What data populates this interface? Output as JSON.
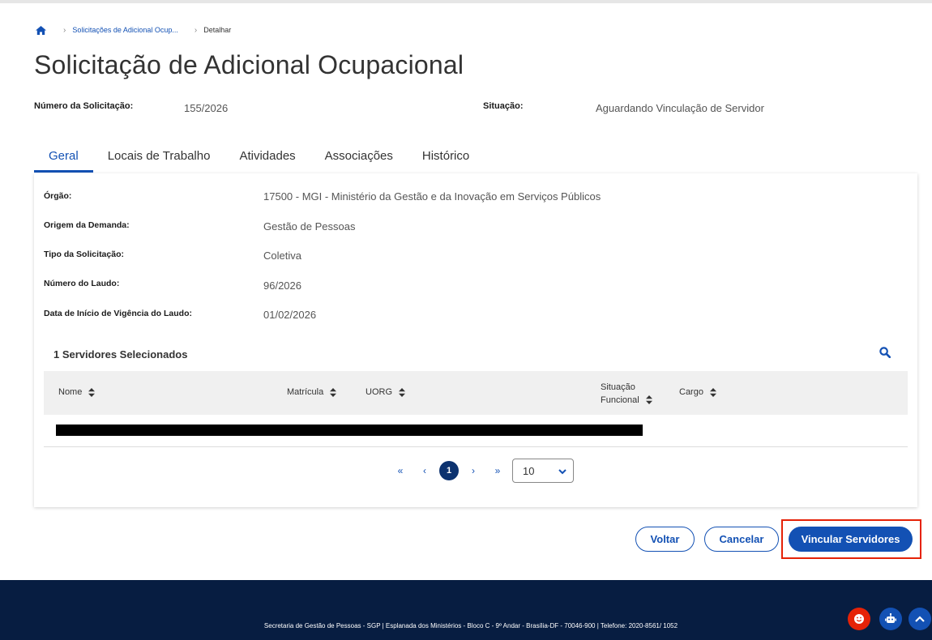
{
  "breadcrumb": {
    "items": [
      "Solicitações de Adicional Ocup...",
      "Detalhar"
    ]
  },
  "page": {
    "title": "Solicitação de Adicional Ocupacional"
  },
  "meta": {
    "numero_label": "Número da Solicitação:",
    "numero_value": "155/2026",
    "situacao_label": "Situação:",
    "situacao_value": "Aguardando Vinculação de Servidor"
  },
  "tabs": [
    {
      "label": "Geral",
      "active": true
    },
    {
      "label": "Locais de Trabalho",
      "active": false
    },
    {
      "label": "Atividades",
      "active": false
    },
    {
      "label": "Associações",
      "active": false
    },
    {
      "label": "Histórico",
      "active": false
    }
  ],
  "details": [
    {
      "label": "Órgão:",
      "value": "17500 - MGI - Ministério da Gestão e da Inovação em Serviços Públicos"
    },
    {
      "label": "Origem da Demanda:",
      "value": "Gestão de Pessoas"
    },
    {
      "label": "Tipo da Solicitação:",
      "value": "Coletiva"
    },
    {
      "label": "Número do Laudo:",
      "value": "96/2026"
    },
    {
      "label": "Data de Início de Vigência do Laudo:",
      "value": "01/02/2026"
    }
  ],
  "servidores": {
    "title": "1 Servidores Selecionados",
    "columns": {
      "nome": "Nome",
      "matricula": "Matrícula",
      "uorg": "UORG",
      "situacao_l1": "Situação",
      "situacao_l2": "Funcional",
      "cargo": "Cargo"
    }
  },
  "pagination": {
    "current_page": "1",
    "page_size": "10",
    "first": "«",
    "prev": "‹",
    "next": "›",
    "last": "»"
  },
  "actions": {
    "voltar": "Voltar",
    "cancelar": "Cancelar",
    "vincular": "Vincular Servidores"
  },
  "footer": {
    "text": "Secretaria de Gestão de Pessoas - SGP | Esplanada dos Ministérios - Bloco C - 9º Andar - Brasília-DF - 70046-900 | Telefone: 2020-8561/ 1052"
  },
  "colors": {
    "primary": "#1351b4",
    "footer": "#071d41",
    "highlight": "#e52207"
  }
}
